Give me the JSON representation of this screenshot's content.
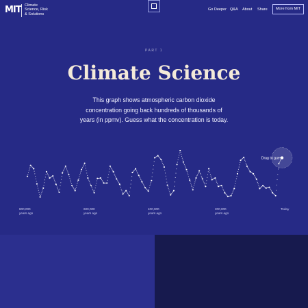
{
  "header": {
    "logo_text": "MIT",
    "site_title_lines": [
      "Climate",
      "Science, Risk",
      "& Solutions"
    ],
    "nav": [
      {
        "label": "Go Deeper"
      },
      {
        "label": "Q&A"
      },
      {
        "label": "About"
      },
      {
        "label": "Share"
      }
    ],
    "more_button": "More from MIT"
  },
  "hero": {
    "eyebrow": "PART 1",
    "title": "Climate Science",
    "intro_lines": [
      "This graph shows atmospheric carbon dioxide",
      "concentration going back hundreds of thousands of",
      "years (in ppmv). Guess what the concentration is today."
    ]
  },
  "guess_prompt": "Drag to guess",
  "axis_labels": [
    {
      "value": "800,000",
      "unit": "years ago"
    },
    {
      "value": "600,000",
      "unit": "years ago"
    },
    {
      "value": "400,000",
      "unit": "years ago"
    },
    {
      "value": "200,000",
      "unit": "years ago"
    },
    {
      "value": "Today",
      "unit": ""
    }
  ],
  "colors": {
    "background": "#262a86",
    "title": "#f4ead9",
    "data_points": "#ffffff",
    "bottom_left_panel": "#2b2f8e",
    "bottom_right_panel": "#171a4e"
  },
  "chart_data": {
    "type": "scatter",
    "xlabel": "",
    "ylabel": "",
    "x_unit": "years ago",
    "y_unit": "ppmv",
    "xlim": [
      800000,
      0
    ],
    "ylim": [
      170,
      300
    ],
    "x_ticks": [
      "800,000 years ago",
      "600,000 years ago",
      "400,000 years ago",
      "200,000 years ago",
      "Today"
    ],
    "x": [
      800000,
      790000,
      780000,
      770000,
      760000,
      750000,
      740000,
      730000,
      720000,
      710000,
      700000,
      690000,
      680000,
      670000,
      660000,
      650000,
      640000,
      630000,
      620000,
      610000,
      600000,
      590000,
      580000,
      570000,
      560000,
      550000,
      540000,
      530000,
      520000,
      510000,
      500000,
      490000,
      480000,
      470000,
      460000,
      450000,
      440000,
      430000,
      420000,
      410000,
      400000,
      390000,
      380000,
      370000,
      360000,
      350000,
      340000,
      330000,
      320000,
      310000,
      300000,
      290000,
      280000,
      270000,
      260000,
      250000,
      240000,
      230000,
      220000,
      210000,
      200000,
      190000,
      180000,
      170000,
      160000,
      150000,
      140000,
      130000,
      120000,
      110000,
      100000,
      90000,
      80000,
      70000,
      60000,
      50000,
      40000,
      30000,
      20000,
      10000,
      0
    ],
    "y": [
      234,
      260,
      252,
      216,
      185,
      206,
      245,
      230,
      235,
      215,
      196,
      242,
      258,
      238,
      212,
      200,
      225,
      250,
      265,
      230,
      212,
      195,
      229,
      230,
      218,
      218,
      258,
      245,
      228,
      215,
      192,
      200,
      188,
      243,
      252,
      236,
      221,
      207,
      199,
      224,
      278,
      283,
      274,
      256,
      213,
      190,
      200,
      262,
      295,
      268,
      250,
      225,
      202,
      230,
      247,
      228,
      210,
      252,
      226,
      230,
      210,
      212,
      195,
      186,
      188,
      205,
      240,
      272,
      279,
      258,
      245,
      240,
      227,
      205,
      212,
      206,
      208,
      195,
      188,
      264,
      278
    ]
  }
}
